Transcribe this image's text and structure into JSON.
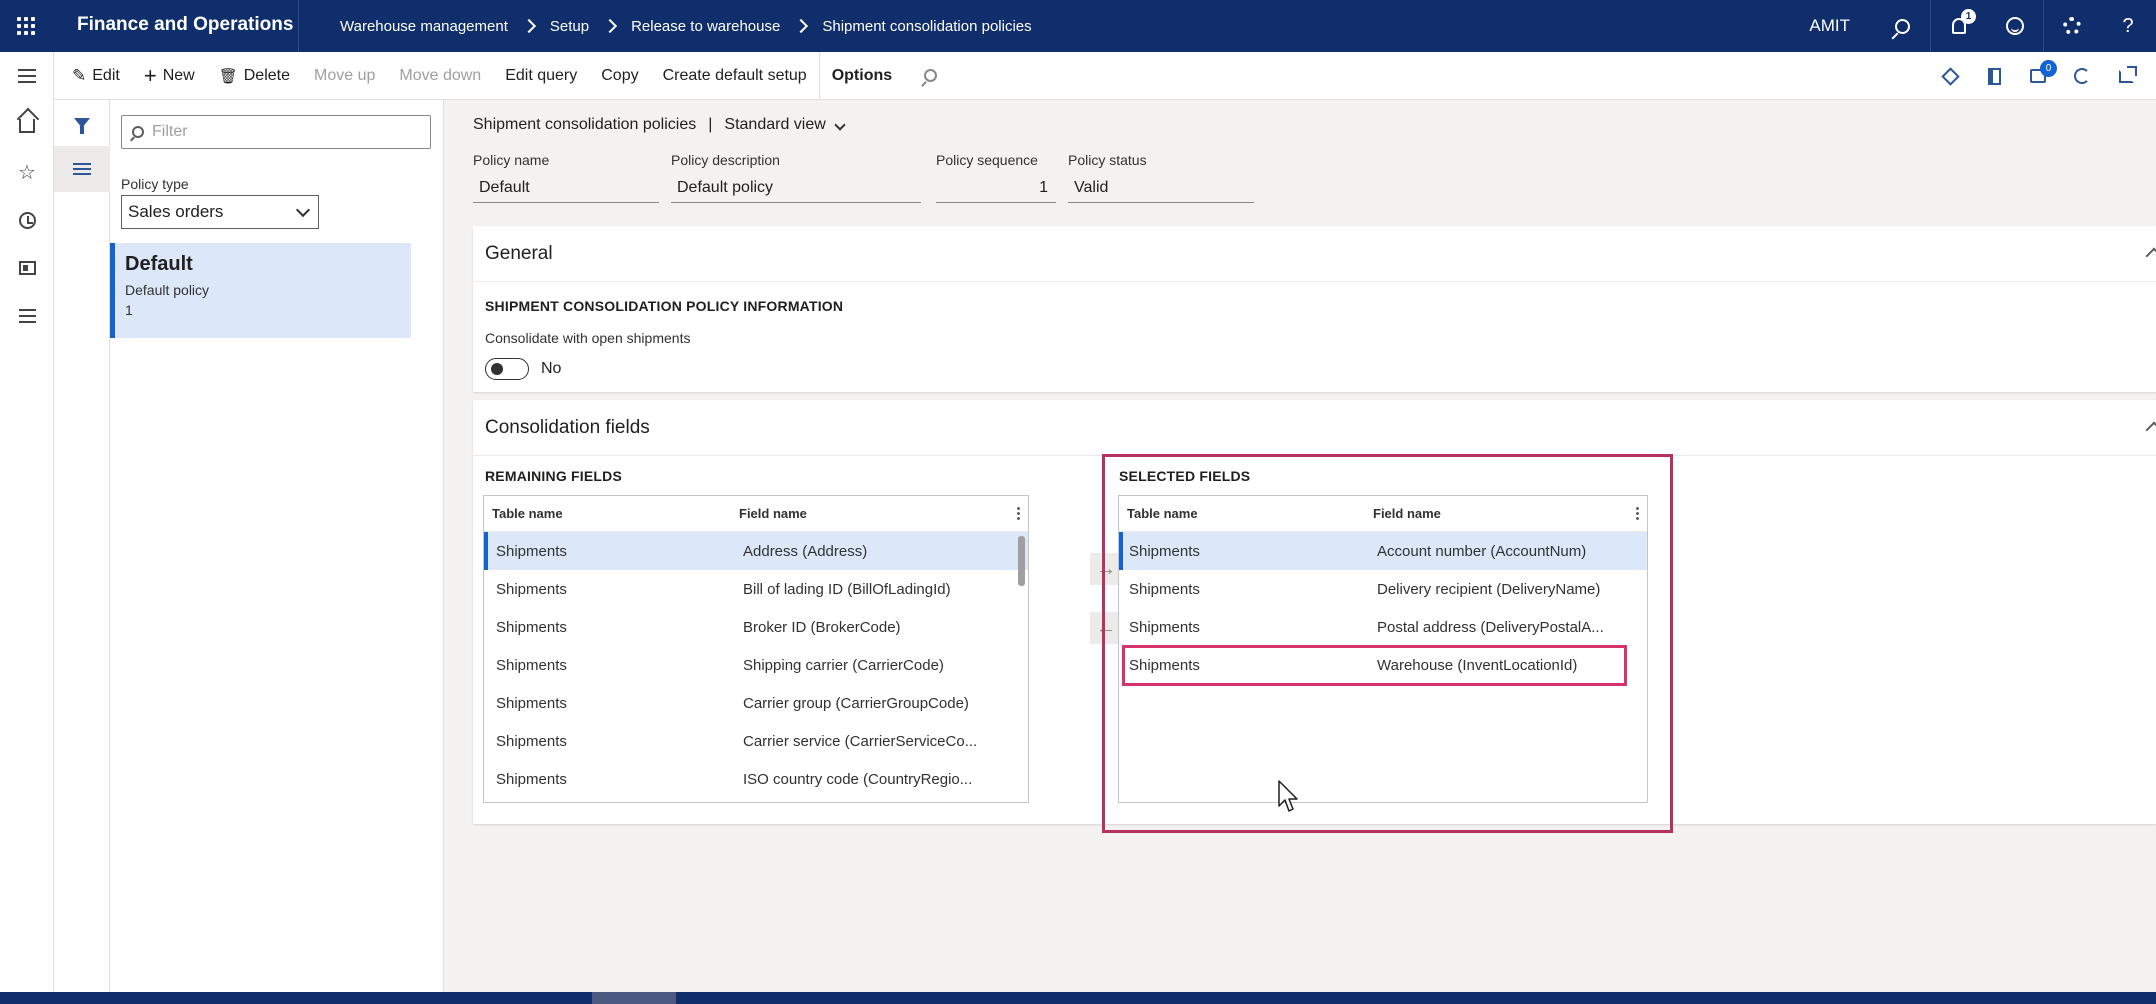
{
  "app": {
    "title": "Finance and Operations",
    "user": "AMIT",
    "notifications_count": "1"
  },
  "breadcrumb": [
    "Warehouse management",
    "Setup",
    "Release to warehouse",
    "Shipment consolidation policies"
  ],
  "actions": {
    "edit": "Edit",
    "new": "New",
    "delete": "Delete",
    "move_up": "Move up",
    "move_down": "Move down",
    "edit_query": "Edit query",
    "copy": "Copy",
    "create_default_setup": "Create default setup",
    "options": "Options",
    "messages_count": "0"
  },
  "listpane": {
    "filter_placeholder": "Filter",
    "policy_type_label": "Policy type",
    "policy_type_value": "Sales orders",
    "record": {
      "name": "Default",
      "description": "Default policy",
      "sequence": "1"
    }
  },
  "header": {
    "form_name": "Shipment consolidation policies",
    "separator": "|",
    "view": "Standard view",
    "fields": {
      "policy_name_label": "Policy name",
      "policy_name": "Default",
      "policy_description_label": "Policy description",
      "policy_description": "Default policy",
      "policy_sequence_label": "Policy sequence",
      "policy_sequence": "1",
      "policy_status_label": "Policy status",
      "policy_status": "Valid"
    }
  },
  "general": {
    "title": "General",
    "section_title": "SHIPMENT CONSOLIDATION POLICY INFORMATION",
    "consolidate_label": "Consolidate with open shipments",
    "consolidate_value": "No"
  },
  "consolidation": {
    "title": "Consolidation fields",
    "remaining_title": "REMAINING FIELDS",
    "selected_title": "SELECTED FIELDS",
    "col_table": "Table name",
    "col_field": "Field name",
    "remaining": [
      {
        "table": "Shipments",
        "field": "Address (Address)"
      },
      {
        "table": "Shipments",
        "field": "Bill of lading ID (BillOfLadingId)"
      },
      {
        "table": "Shipments",
        "field": "Broker ID (BrokerCode)"
      },
      {
        "table": "Shipments",
        "field": "Shipping carrier (CarrierCode)"
      },
      {
        "table": "Shipments",
        "field": "Carrier group (CarrierGroupCode)"
      },
      {
        "table": "Shipments",
        "field": "Carrier service (CarrierServiceCo..."
      },
      {
        "table": "Shipments",
        "field": "ISO country code (CountryRegio..."
      }
    ],
    "selected": [
      {
        "table": "Shipments",
        "field": "Account number (AccountNum)"
      },
      {
        "table": "Shipments",
        "field": "Delivery recipient (DeliveryName)"
      },
      {
        "table": "Shipments",
        "field": "Postal address (DeliveryPostalA..."
      },
      {
        "table": "Shipments",
        "field": "Warehouse (InventLocationId)"
      }
    ],
    "add_arrow": "→",
    "remove_arrow": "←"
  },
  "icons": {
    "add": "+",
    "delete": "🗑",
    "edit": "✎",
    "star": "☆"
  },
  "colors": {
    "topbar": "#0f2e6b",
    "accent": "#1463d2",
    "highlight": "#b5315f"
  }
}
